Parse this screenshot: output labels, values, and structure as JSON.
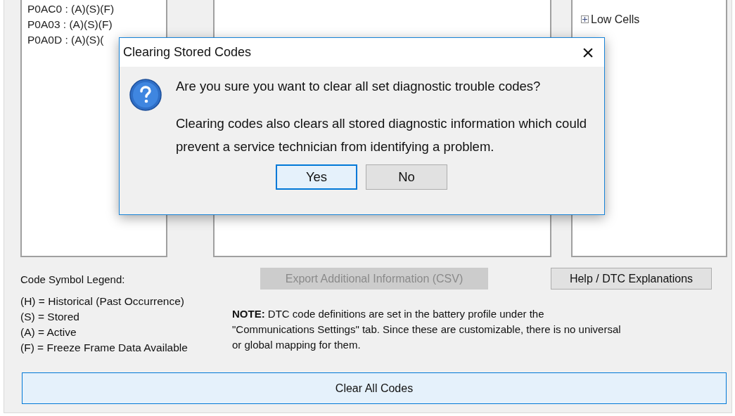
{
  "code_list": [
    "P0AC0 : (A)(S)(F)",
    "P0A03 : (A)(S)(F)",
    "P0A0D : (A)(S)("
  ],
  "tree": [
    {
      "label": "Low Cells",
      "expanded": false
    }
  ],
  "legend": {
    "title": "Code Symbol Legend:",
    "items": [
      "(H) = Historical (Past Occurrence)",
      "(S) = Stored",
      "(A) = Active",
      "(F) = Freeze Frame Data Available"
    ]
  },
  "export_button": {
    "label": "Export Additional Information (CSV)",
    "disabled": true
  },
  "help_button": {
    "label": "Help / DTC Explanations",
    "disabled": false
  },
  "note": "**NOTE:** DTC code definitions are set in the battery profile under the \"Communications Settings\" tab. Since these are customizable, there is no universal or global mapping for them.",
  "clear_button": {
    "label": "Clear All Codes"
  },
  "dialog": {
    "title": "Clearing Stored Codes",
    "close": "×",
    "question": "Are you sure you want to clear all set diagnostic trouble codes?",
    "detail": "Clearing codes also clears all stored diagnostic information which could prevent a service technician from identifying a problem.",
    "buttons": [
      {
        "label": "Yes",
        "selected": true
      },
      {
        "label": "No",
        "selected": false
      }
    ]
  }
}
